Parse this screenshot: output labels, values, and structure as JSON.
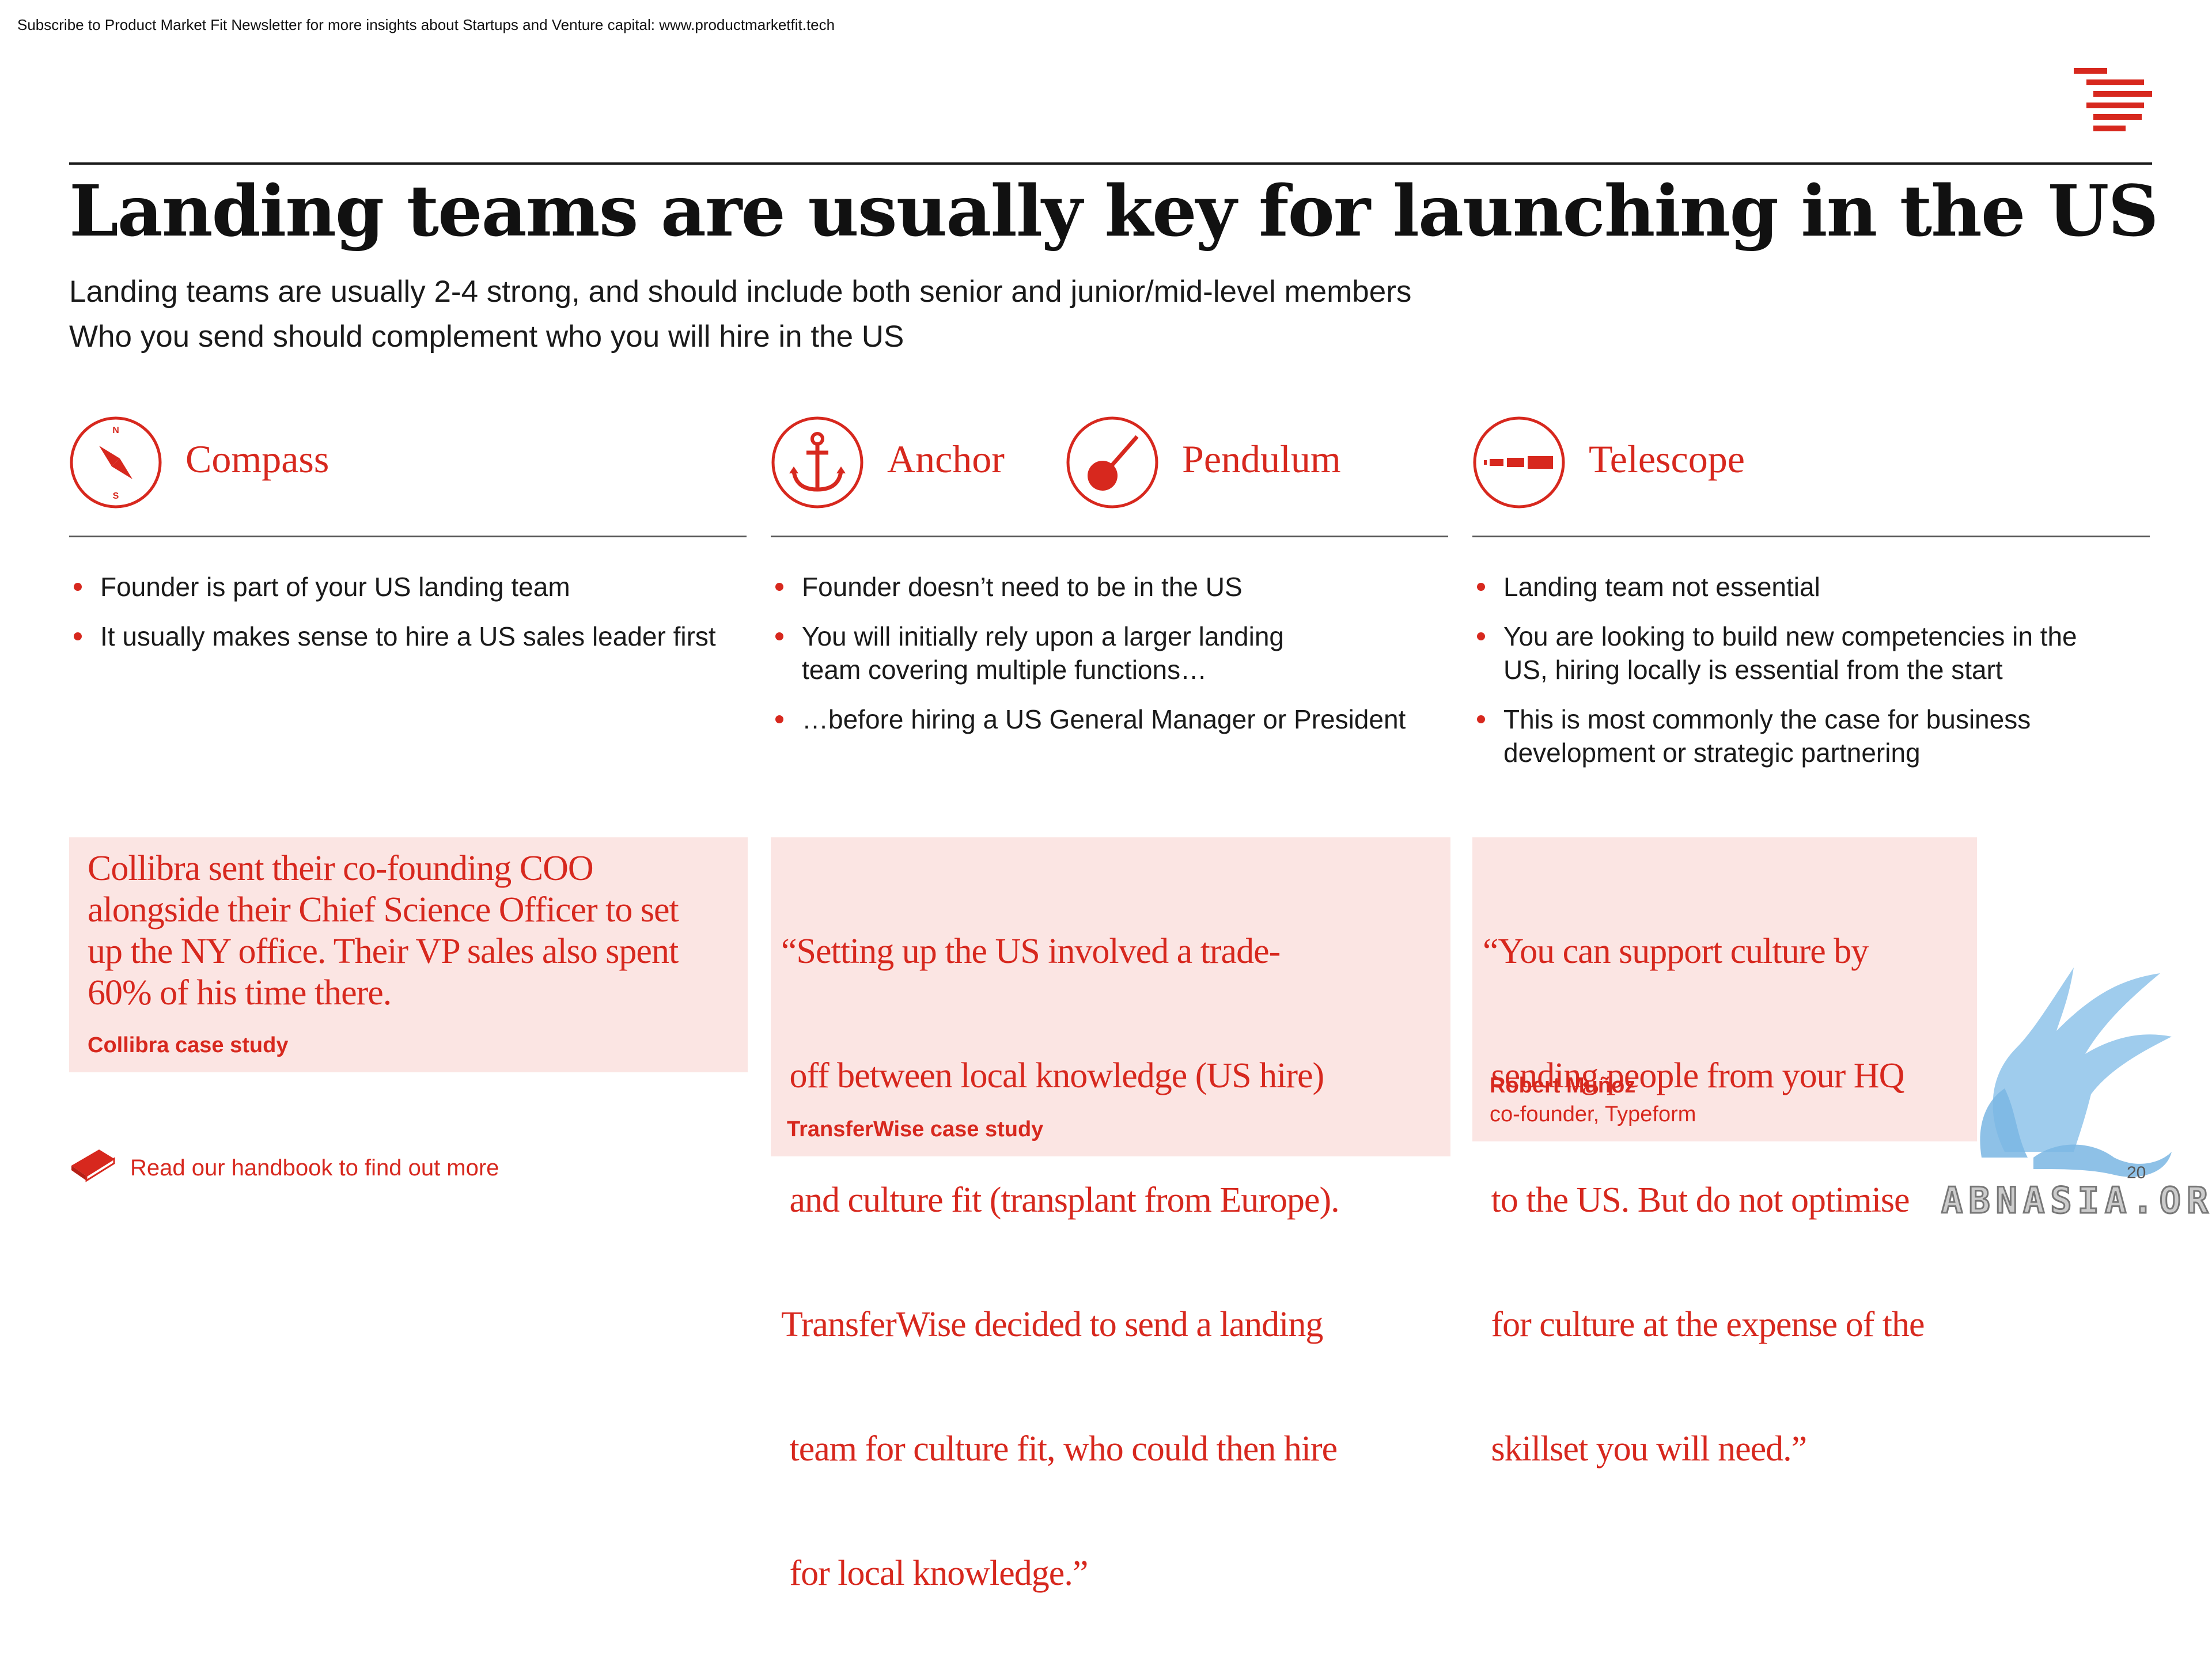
{
  "top_note": "Subscribe to Product Market Fit Newsletter for more insights about Startups and Venture capital:  www.productmarketfit.tech",
  "title": "Landing teams are usually key for launching in the US",
  "subtitle": [
    "Landing teams are usually 2-4 strong, and should include both senior and junior/mid-level members",
    "Who you send should complement who you will hire in the US"
  ],
  "columns": [
    {
      "icon": "compass-icon",
      "compass_n": "N",
      "compass_s": "S",
      "heading": "Compass",
      "bullets": [
        "Founder is part of your US landing team",
        "It usually makes sense to hire a US sales leader first"
      ]
    },
    {
      "icon": "anchor-icon",
      "heading": "Anchor",
      "icon2": "pendulum-icon",
      "heading2": "Pendulum",
      "bullets": [
        "Founder doesn’t need to be in the US",
        "You will initially rely upon a larger landing team covering multiple functions…",
        "…before hiring a US General Manager or President"
      ]
    },
    {
      "icon": "telescope-icon",
      "heading": "Telescope",
      "bullets": [
        "Landing team not essential",
        "You are looking to build new competencies in the US, hiring locally is essential from the start",
        "This is most commonly the case for business development or strategic partnering"
      ]
    }
  ],
  "quotes": [
    {
      "lines": [
        "Collibra sent their co-founding COO",
        "alongside their Chief Science Officer to set",
        "up the NY office. Their VP sales also spent",
        "60% of his time there."
      ],
      "source": "Collibra case study"
    },
    {
      "lines": [
        "“Setting up the US involved a trade-",
        " off between local knowledge (US hire)",
        " and culture fit (transplant from Europe).",
        "TransferWise decided to send a landing",
        " team for culture fit, who could then hire",
        " for local knowledge.”"
      ],
      "source": "TransferWise case study"
    },
    {
      "lines": [
        "“You can support culture by",
        " sending people from your HQ",
        " to the US. But do not optimise",
        " for culture at the expense of the",
        " skillset you will need.”"
      ],
      "source": "Robert Muñoz",
      "source_sub": "co-founder, Typeform"
    }
  ],
  "handbook_link": "Read our handbook to find out more",
  "page_number": "20",
  "watermark": "ABNASIA.ORG",
  "colors": {
    "accent": "#d7281e",
    "quote_bg": "#fbe5e3",
    "text": "#1a1a1a"
  }
}
